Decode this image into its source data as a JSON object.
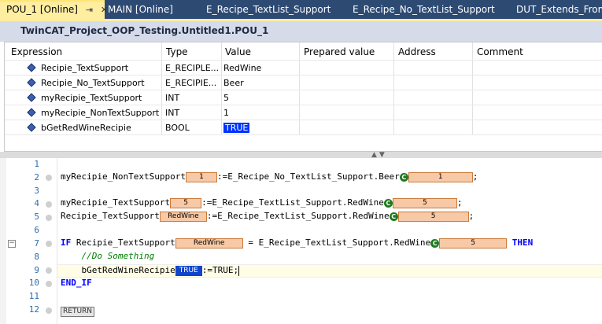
{
  "tabs": [
    {
      "label": "POU_1 [Online]",
      "pin": "⇥",
      "close": "✕"
    },
    {
      "label": "MAIN [Online]"
    },
    {
      "label": "E_Recipe_TextList_Support"
    },
    {
      "label": "E_Recipe_No_TextList_Support"
    },
    {
      "label": "DUT_Extends_From_D"
    }
  ],
  "window_title": "TwinCAT_Project_OOP_Testing.Untitled1.POU_1",
  "watch": {
    "headers": [
      "Expression",
      "Type",
      "Value",
      "Prepared value",
      "Address",
      "Comment"
    ],
    "rows": [
      {
        "expr": "Recipie_TextSupport",
        "type": "E_RECIPLE...",
        "value": "RedWine",
        "highlight": false
      },
      {
        "expr": "Recipie_No_TextSupport",
        "type": "E_RECIPIE...",
        "value": "Beer",
        "highlight": false
      },
      {
        "expr": "myRecipie_TextSupport",
        "type": "INT",
        "value": "5",
        "highlight": false
      },
      {
        "expr": "myRecipie_NonTextSupport",
        "type": "INT",
        "value": "1",
        "highlight": false
      },
      {
        "expr": "bGetRedWineRecipie",
        "type": "BOOL",
        "value": "TRUE",
        "highlight": true
      }
    ],
    "icon": "variable-icon"
  },
  "editor": {
    "line_numbers": [
      "1",
      "2",
      "3",
      "4",
      "5",
      "6",
      "7",
      "8",
      "9",
      "10",
      "11",
      "12"
    ],
    "l2": {
      "a": "myRecipie_NonTextSupport",
      "v1": "1",
      "b": ":=E_Recipe_No_TextList_Support.Beer",
      "c": "C",
      "v2": "1",
      "d": ";"
    },
    "l4": {
      "a": "myRecipie_TextSupport",
      "v1": "5",
      "b": ":=E_Recipe_TextList_Support.RedWine",
      "c": "C",
      "v2": "5",
      "d": ";"
    },
    "l5": {
      "a": "Recipie_TextSupport",
      "v1": "RedWine",
      "b": ":=E_Recipe_TextList_Support.RedWine",
      "c": "C",
      "v2": "5",
      "d": ";"
    },
    "l7": {
      "kw1": "IF",
      "a": " Recipie_TextSupport",
      "v1": "RedWine",
      "b": " = E_Recipe_TextList_Support.RedWine",
      "c": "C",
      "v2": "5",
      "kw2": "THEN"
    },
    "l8": {
      "comment": "//Do Something"
    },
    "l9": {
      "a": "bGetRedWineRecipie",
      "v1": "TRUE",
      "b": ":=TRUE;"
    },
    "l10": {
      "kw": "END_IF"
    },
    "l12": {
      "ret": "RETURN"
    }
  }
}
